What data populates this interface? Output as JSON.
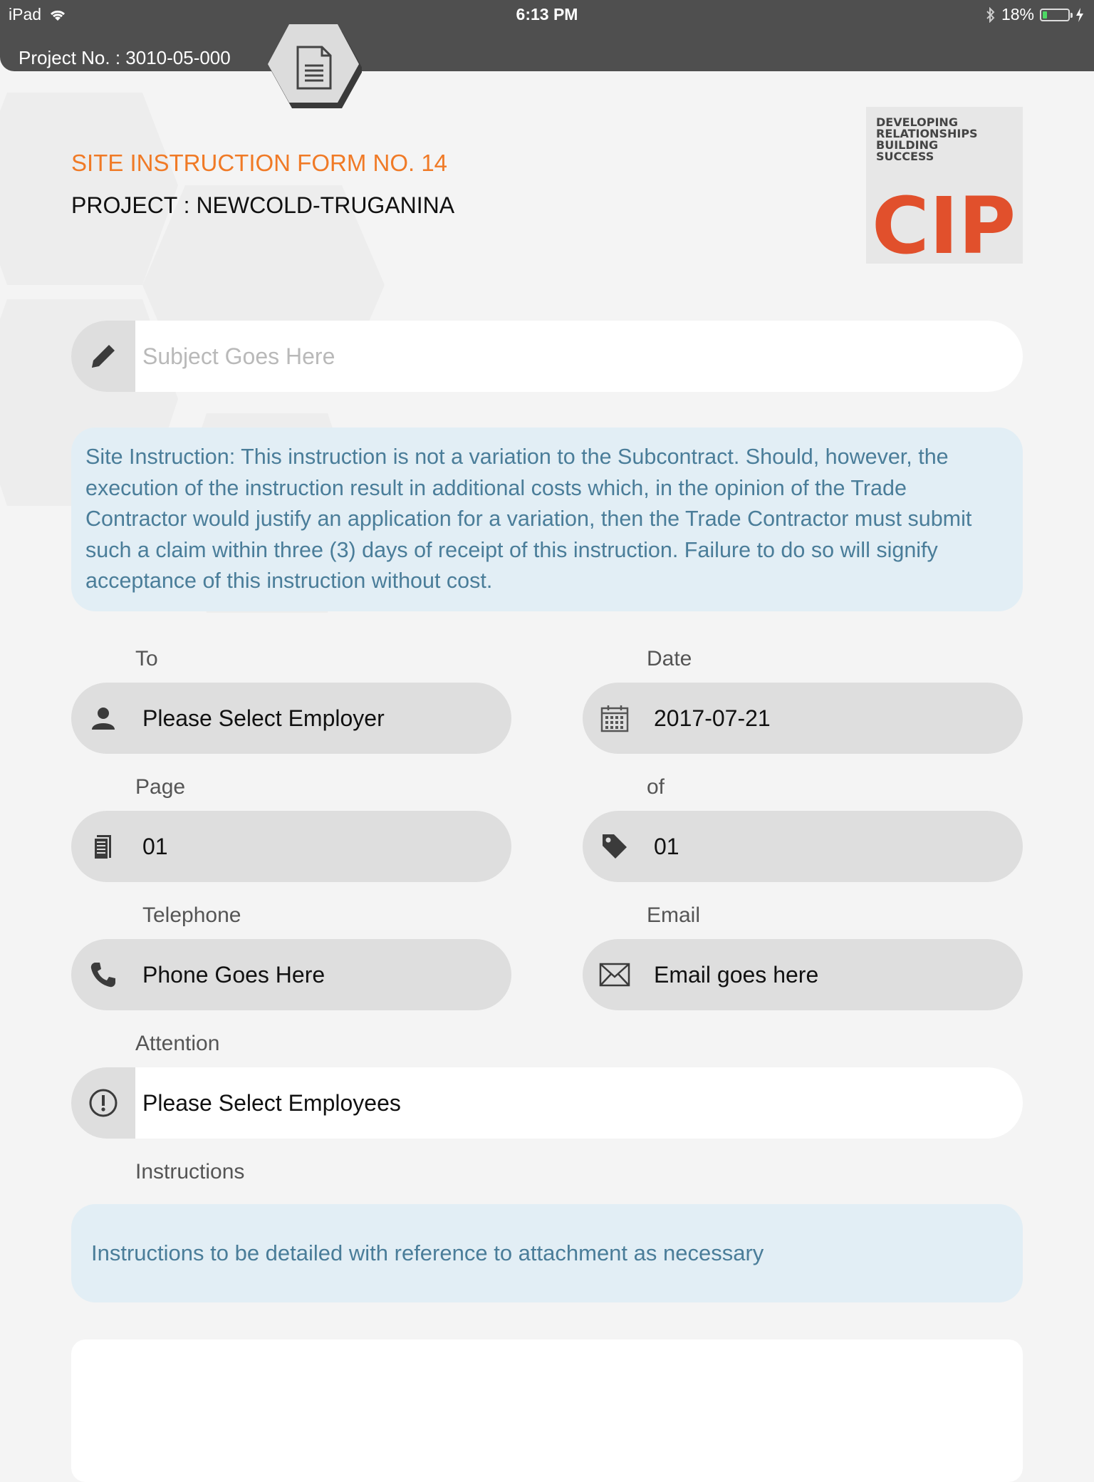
{
  "status_bar": {
    "device": "iPad",
    "time": "6:13 PM",
    "battery": "18%",
    "battery_level": 0.18
  },
  "header": {
    "project_number": "Project No. : 3010-05-000",
    "form_title": "SITE INSTRUCTION FORM NO. 14",
    "project_title": "PROJECT : NEWCOLD-TRUGANINA"
  },
  "logo": {
    "tagline": "DEVELOPING\nRELATIONSHIPS\nBUILDING\nSUCCESS",
    "brand": "CIP"
  },
  "subject": {
    "placeholder": "Subject Goes Here"
  },
  "notice": {
    "text": "Site Instruction: This instruction is not a variation to the Subcontract. Should, however, the execution of the instruction result in additional costs which, in the opinion of the Trade Contractor would justify an application for a variation, then the Trade Contractor must submit such a claim within three (3) days of receipt of this instruction. Failure to do so will signify acceptance of this instruction without cost."
  },
  "fields": {
    "to": {
      "label": "To",
      "value": "Please Select Employer"
    },
    "date": {
      "label": "Date",
      "value": "2017-07-21"
    },
    "page": {
      "label": "Page",
      "value": "01"
    },
    "of": {
      "label": "of",
      "value": "01"
    },
    "telephone": {
      "label": "Telephone",
      "value": "Phone Goes Here"
    },
    "email": {
      "label": "Email",
      "value": "Email goes here"
    },
    "attention": {
      "label": "Attention",
      "value": "Please Select Employees"
    },
    "instructions": {
      "label": "Instructions",
      "value": "Instructions to be detailed with reference to attachment as necessary"
    }
  },
  "colors": {
    "accent": "#f07a26",
    "header_bg": "#4f4f4f",
    "notice_bg": "#e2eef5",
    "notice_text": "#4a7d99",
    "logo_red": "#e1502c"
  },
  "icons": {
    "status": [
      "wifi-icon",
      "bluetooth-icon",
      "battery-icon",
      "charging-icon"
    ],
    "header": [
      "document-icon"
    ],
    "fields": [
      "pencil-icon",
      "person-icon",
      "calendar-icon",
      "pages-icon",
      "tag-icon",
      "phone-icon",
      "envelope-icon",
      "alert-icon"
    ]
  }
}
